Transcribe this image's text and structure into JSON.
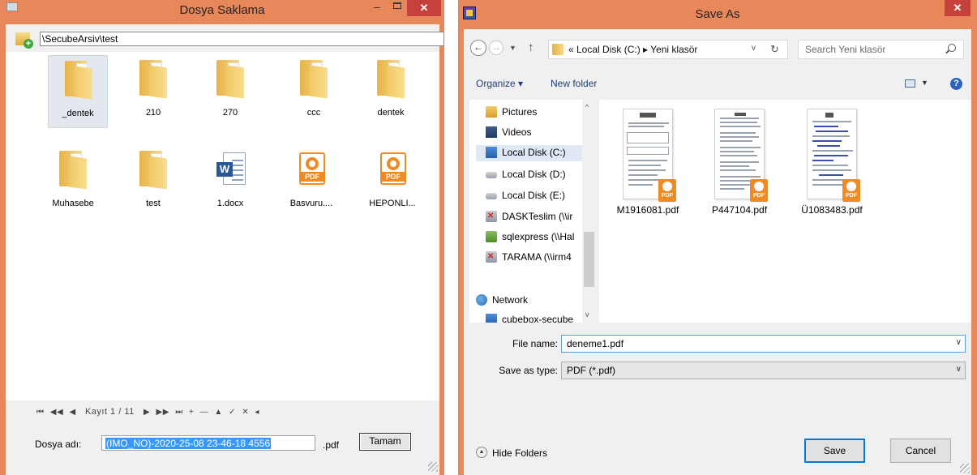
{
  "left_window": {
    "title": "Dosya Saklama",
    "minimize_glyph": "–",
    "close_glyph": "✕",
    "path": "\\SecubeArsiv\\test",
    "items": [
      {
        "name": "_dentek",
        "icon": "folder-icon"
      },
      {
        "name": "210",
        "icon": "folder-icon"
      },
      {
        "name": "270",
        "icon": "folder-icon"
      },
      {
        "name": "ccc",
        "icon": "folder-icon"
      },
      {
        "name": "dentek",
        "icon": "folder-icon"
      },
      {
        "name": "Muhasebe",
        "icon": "folder-icon"
      },
      {
        "name": "test",
        "icon": "folder-icon"
      },
      {
        "name": "1.docx",
        "icon": "word-document-icon"
      },
      {
        "name": "Basvuru....",
        "icon": "pdf-file-icon"
      },
      {
        "name": "HEPONLI...",
        "icon": "pdf-file-icon"
      }
    ],
    "navigator": {
      "first": "⏮",
      "prev_page": "◀◀",
      "prev": "◀",
      "record_text": "Kayıt 1 / 11",
      "next": "▶",
      "next_page": "▶▶",
      "last": "⏭",
      "add": "+",
      "delete": "—",
      "edit": "▲",
      "post": "✓",
      "cancel": "✕",
      "refresh": "◂"
    },
    "file_name_label": "Dosya adı:",
    "file_name_value": "(IMO_NO)-2020-25-08 23-46-18 4556",
    "extension": ".pdf",
    "ok_button": "Tamam"
  },
  "right_window": {
    "title": "Save As",
    "close_glyph": "✕",
    "back_glyph": "←",
    "forward_glyph": "→",
    "recent_glyph": "▼",
    "up_glyph": "↑",
    "address_path": "« Local Disk (C:) ▸ Yeni klasör",
    "address_dropdown_glyph": "v",
    "refresh_glyph": "↻",
    "search_placeholder": "Search Yeni klasör",
    "organize": "Organize ▾",
    "new_folder": "New folder",
    "view_dropdown_glyph": "▼",
    "help_glyph": "?",
    "tree": [
      {
        "label": "Pictures",
        "icon": "pictures-folder-icon"
      },
      {
        "label": "Videos",
        "icon": "videos-folder-icon"
      },
      {
        "label": "Local Disk (C:)",
        "icon": "system-drive-icon"
      },
      {
        "label": "Local Disk (D:)",
        "icon": "drive-icon"
      },
      {
        "label": "Local Disk (E:)",
        "icon": "drive-icon"
      },
      {
        "label": "DASKTeslim (\\\\ir",
        "icon": "disconnected-network-drive-icon"
      },
      {
        "label": "sqlexpress (\\\\Hal",
        "icon": "network-drive-icon"
      },
      {
        "label": "TARAMA (\\\\irm4",
        "icon": "disconnected-network-drive-icon"
      },
      {
        "label": "Network",
        "icon": "network-icon"
      },
      {
        "label": "cubebox-secube",
        "icon": "computer-icon"
      }
    ],
    "tree_scroll_up_glyph": "^",
    "tree_scroll_down_glyph": "v",
    "files": [
      "M1916081.pdf",
      "P447104.pdf",
      "Ü1083483.pdf"
    ],
    "file_name_label": "File name:",
    "file_name_value": "deneme1.pdf",
    "save_type_label": "Save as type:",
    "save_type_value": "PDF (*.pdf)",
    "combo_glyph": "∨",
    "hide_folders_glyph": "▲",
    "hide_folders": "Hide Folders",
    "save_button": "Save",
    "cancel_button": "Cancel"
  },
  "colors": {
    "title_bar": "#e8875a",
    "close_button": "#c7413c",
    "selection": "#3399ff",
    "pdf_orange": "#f08a24"
  }
}
